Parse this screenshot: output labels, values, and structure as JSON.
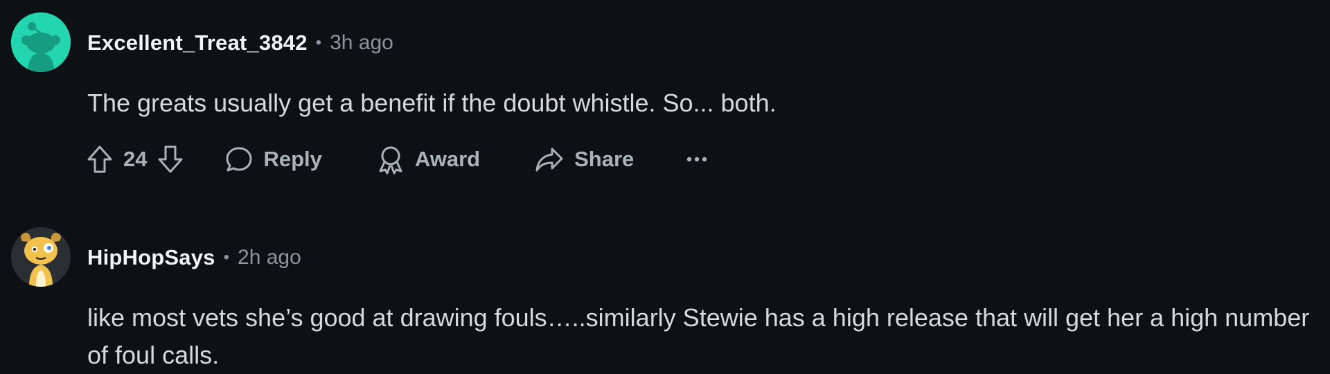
{
  "comments": [
    {
      "username": "Excellent_Treat_3842",
      "separator": "•",
      "time": "3h ago",
      "body": "The greats usually get a benefit if the doubt whistle. So... both.",
      "actions": {
        "upvote_icon": "upvote-arrow-icon",
        "vote_count": "24",
        "downvote_icon": "downvote-arrow-icon",
        "reply_label": "Reply",
        "award_label": "Award",
        "share_label": "Share",
        "more_label": "•••"
      }
    },
    {
      "username": "HipHopSays",
      "separator": "•",
      "time": "2h ago",
      "body": "like most vets she’s good at drawing fouls…..similarly Stewie has a high release that will get her a high number of foul calls."
    }
  ],
  "colors": {
    "background": "#0e1113",
    "avatar1": "#24d6b0",
    "meta": "#8b969e",
    "action": "#a9b3ba"
  }
}
